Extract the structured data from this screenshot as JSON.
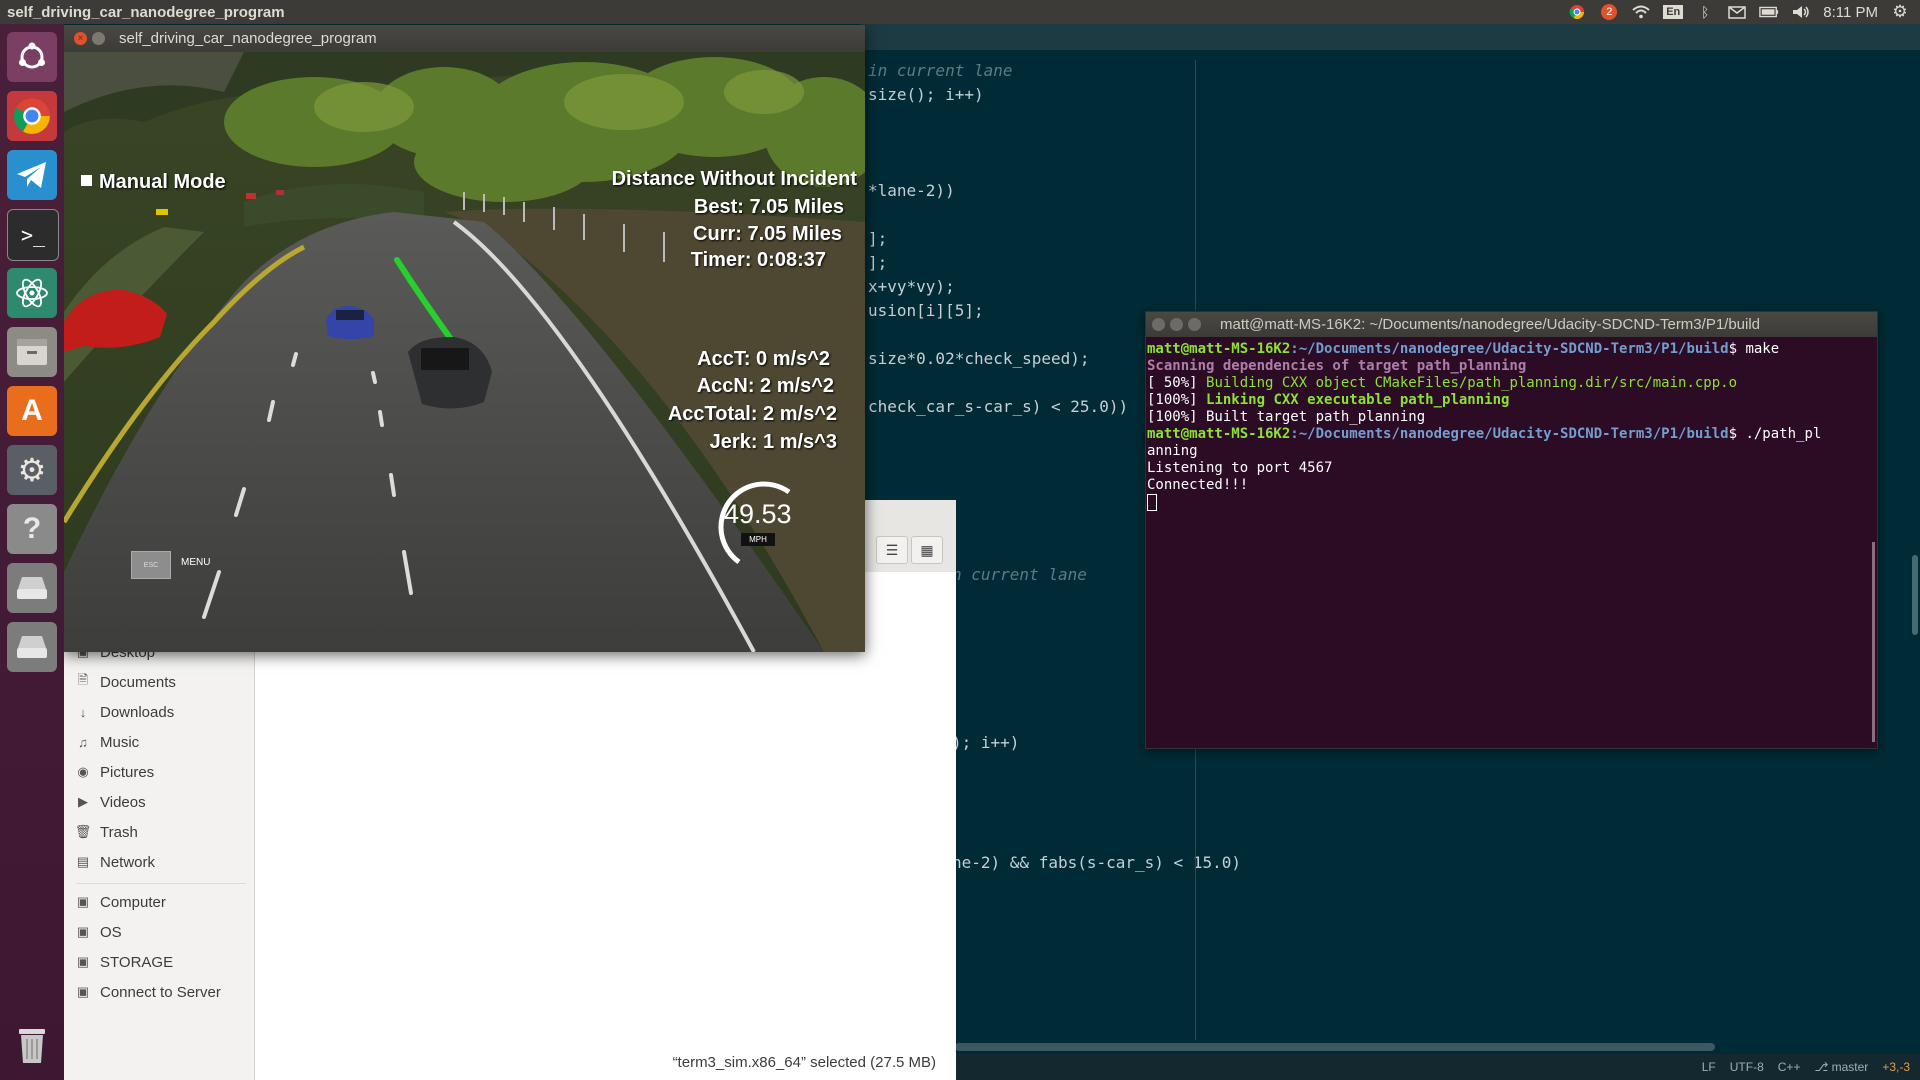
{
  "top_panel": {
    "app_title": "self_driving_car_nanodegree_program",
    "notification_count": "2",
    "keyboard_layout": "En",
    "clock": "8:11 PM"
  },
  "launcher": {
    "items": [
      "ubuntu-dash",
      "chrome",
      "telegram",
      "terminal",
      "atom",
      "files",
      "software-center",
      "system-settings",
      "help",
      "drive-1",
      "drive-2",
      "trash"
    ]
  },
  "editor": {
    "lines": [
      {
        "t": "in current lane",
        "cls": "cmt"
      },
      {
        "t": "size(); i++)",
        "cls": ""
      },
      {
        "t": "*lane-2))",
        "cls": ""
      },
      {
        "t": "];",
        "cls": ""
      },
      {
        "t": "];",
        "cls": ""
      },
      {
        "t": "x+vy*vy);",
        "cls": ""
      },
      {
        "t": "usion[i][5];",
        "cls": ""
      },
      {
        "t": "size*0.02*check_speed);",
        "cls": ""
      },
      {
        "t": "check_car_s-car_s) < 25.0))",
        "cls": ""
      },
      {
        "t": "n current lane",
        "cls": "cmt"
      },
      {
        "t": "); i++)",
        "cls": ""
      },
      {
        "t": "ne-2) && fabs(s-car_s) < 15.0)",
        "cls": ""
      }
    ],
    "status": {
      "eol": "LF",
      "encoding": "UTF-8",
      "language": "C++",
      "branch": "master",
      "changes": "+3,-3"
    }
  },
  "file_manager": {
    "places": [
      "Desktop",
      "Documents",
      "Downloads",
      "Music",
      "Pictures",
      "Videos",
      "Trash",
      "Network"
    ],
    "devices": [
      "Computer",
      "OS",
      "STORAGE",
      "Connect to Server"
    ],
    "status": "“term3_sim.x86_64” selected  (27.5 MB)"
  },
  "terminal": {
    "title": "matt@matt-MS-16K2: ~/Documents/nanodegree/Udacity-SDCND-Term3/P1/build",
    "prompt_user": "matt@matt-MS-16K2",
    "prompt_path": ":~/Documents/nanodegree/Udacity-SDCND-Term3/P1/build",
    "cmd1": "$ make",
    "scan_line": "Scanning dependencies of target path_planning",
    "build_pct": "[ 50%] ",
    "build_line": "Building CXX object CMakeFiles/path_planning.dir/src/main.cpp.o",
    "link_pct": "[100%] ",
    "link_line": "Linking CXX executable path_planning",
    "built_line": "[100%] Built target path_planning",
    "cmd2": "$ ./path_pl",
    "cmd2_wrap": "anning",
    "listen_line": "Listening to port 4567",
    "connected_line": "Connected!!!"
  },
  "simulator": {
    "title": "self_driving_car_nanodegree_program",
    "mode": "Manual Mode",
    "distance_heading": "Distance Without Incident",
    "best": "Best: 7.05 Miles",
    "curr": "Curr: 7.05 Miles",
    "timer": "Timer: 0:08:37",
    "acct": "AccT: 0 m/s^2",
    "accn": "AccN: 2 m/s^2",
    "acctotal": "AccTotal: 2 m/s^2",
    "jerk": "Jerk: 1 m/s^3",
    "speed": "49.53",
    "speed_unit": "MPH",
    "esc": "ESC",
    "menu": "MENU"
  }
}
